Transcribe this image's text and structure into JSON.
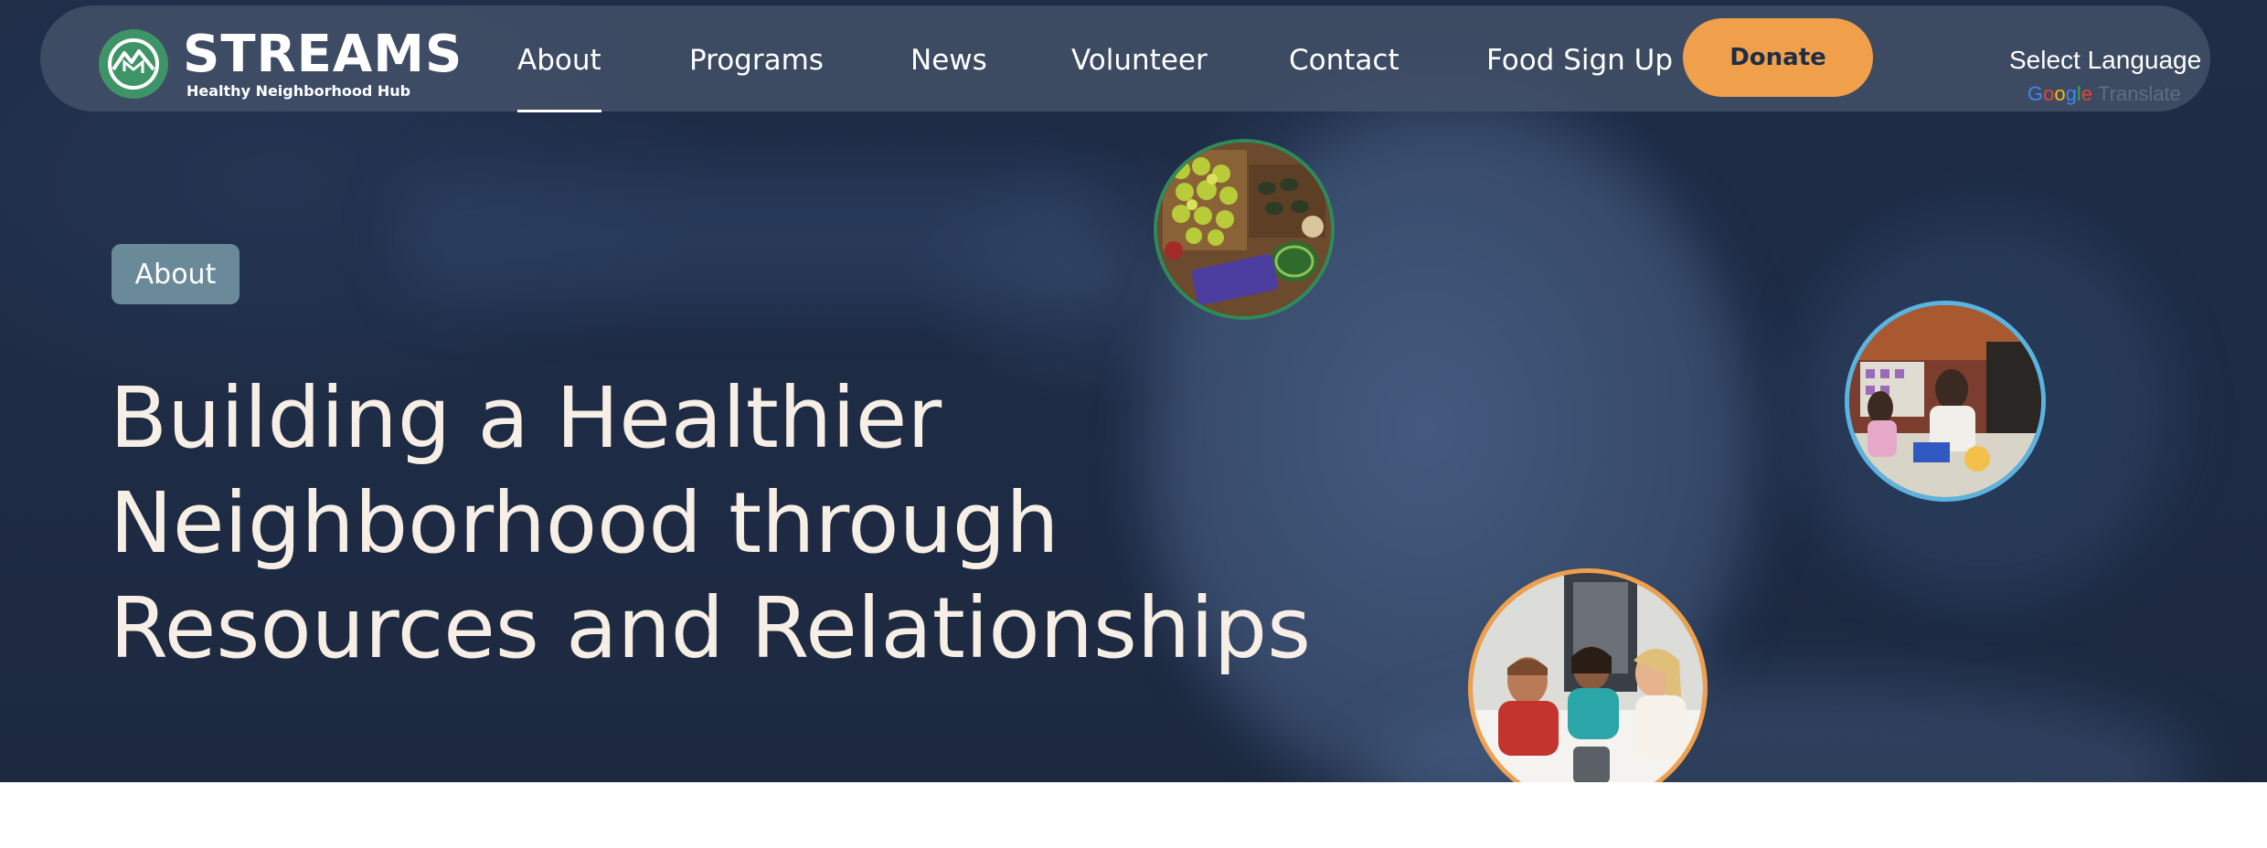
{
  "brand": {
    "name": "STREAMS",
    "tagline": "Healthy Neighborhood Hub",
    "logo_icon": "mountain-stream-logo-icon",
    "logo_color": "#3e9467"
  },
  "nav": {
    "items": [
      {
        "label": "About",
        "active": true
      },
      {
        "label": "Programs",
        "active": false
      },
      {
        "label": "News",
        "active": false
      },
      {
        "label": "Volunteer",
        "active": false
      },
      {
        "label": "Contact",
        "active": false
      },
      {
        "label": "Food Sign Up",
        "active": false
      }
    ],
    "donate_label": "Donate",
    "donate_color": "#f0a04b"
  },
  "translate": {
    "label": "Select Language",
    "powered_by": "Google",
    "suffix": "Translate"
  },
  "hero": {
    "tag": "About",
    "headline": [
      "Building a Healthier",
      "Neighborhood through",
      "Resources and Relationships"
    ],
    "background_color": "#1f2d47",
    "photos": [
      {
        "name": "produce-boxes-photo",
        "border_color": "#2f8a5a"
      },
      {
        "name": "kitchen-activity-photo",
        "border_color": "#5bb3e0"
      },
      {
        "name": "kids-at-table-photo",
        "border_color": "#f0a04b"
      }
    ]
  }
}
